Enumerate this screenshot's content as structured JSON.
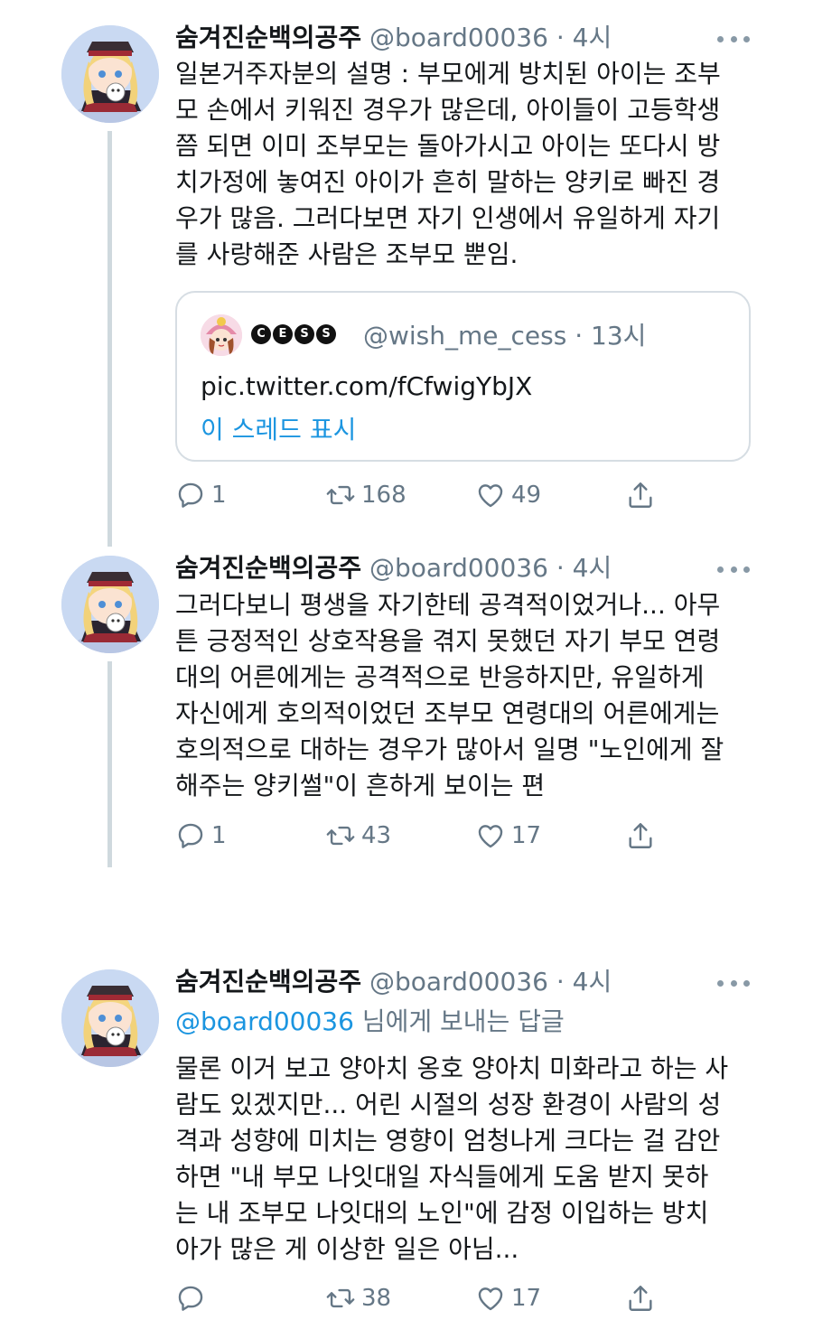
{
  "tweets": [
    {
      "name": "숨겨진순백의공주",
      "handle": "@board00036",
      "dot": "·",
      "time": "4시",
      "body_lines": [
        "일본거주자분의 설명 : 부모에게 방치된 아이는 조부",
        "모 손에서 키워진 경우가 많은데, 아이들이 고등학생",
        "쯤 되면 이미 조부모는 돌아가시고 아이는 또다시 방",
        "치가정에 놓여진 아이가 흔히 말하는 양키로 빠진 경",
        "우가 많음. 그러다보면 자기 인생에서 유일하게 자기",
        "를 사랑해준 사람은 조부모 뿐임."
      ],
      "quote": {
        "badges": [
          "C",
          "E",
          "S",
          "S"
        ],
        "handle": "@wish_me_cess",
        "dot": "·",
        "time": "13시",
        "link": "pic.twitter.com/fCfwigYbJX",
        "thread_label": "이 스레드 표시"
      },
      "replies": "1",
      "retweets": "168",
      "likes": "49"
    },
    {
      "name": "숨겨진순백의공주",
      "handle": "@board00036",
      "dot": "·",
      "time": "4시",
      "body_lines": [
        "그러다보니 평생을 자기한테 공격적이었거나... 아무",
        "튼 긍정적인 상호작용을 겪지 못했던 자기 부모 연령",
        "대의 어른에게는 공격적으로 반응하지만, 유일하게",
        "자신에게 호의적이었던 조부모 연령대의 어른에게는",
        "호의적으로 대하는 경우가 많아서 일명 \"노인에게 잘",
        "해주는 양키썰\"이 흔하게 보이는 편"
      ],
      "replies": "1",
      "retweets": "43",
      "likes": "17"
    },
    {
      "name": "숨겨진순백의공주",
      "handle": "@board00036",
      "dot": "·",
      "time": "4시",
      "reply_to": {
        "mention": "@board00036",
        "suffix": " 님에게 보내는 답글"
      },
      "body_lines": [
        "물론 이거 보고 양아치 옹호 양아치 미화라고 하는 사",
        "람도 있겠지만... 어린 시절의 성장 환경이 사람의 성",
        "격과 성향에 미치는 영향이 엄청나게 크다는 걸 감안",
        "하면 \"내 부모 나잇대일 자식들에게 도움 받지 못하",
        "는 내 조부모 나잇대의 노인\"에 감정 이입하는 방치",
        "아가 많은 게 이상한 일은 아님..."
      ],
      "replies": "",
      "retweets": "38",
      "likes": "17"
    }
  ],
  "icons": {
    "reply": "reply-icon",
    "retweet": "retweet-icon",
    "like": "heart-icon",
    "share": "share-icon",
    "more": "more-icon"
  },
  "colors": {
    "link_blue": "#1b95e0",
    "muted_gray": "#657786",
    "thread_line": "#cfd9de"
  }
}
